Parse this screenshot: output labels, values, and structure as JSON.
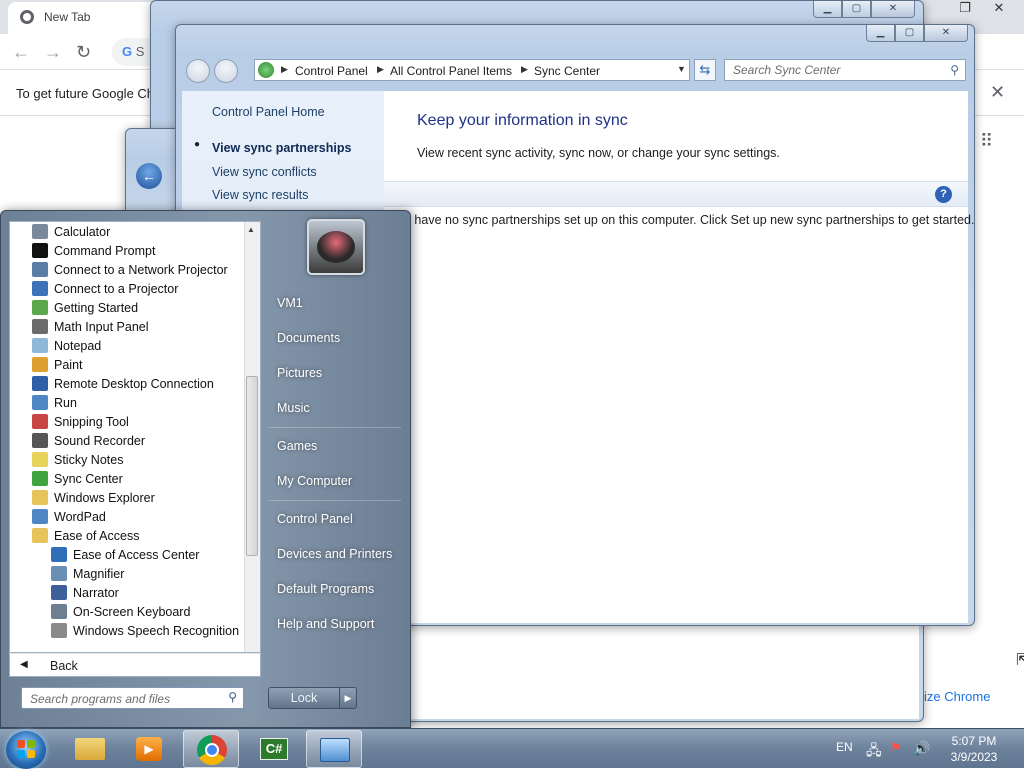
{
  "chrome": {
    "tab_title": "New Tab",
    "search_prefix": "S",
    "infobar_text": "To get future Google Ch",
    "customize_text": "ize Chrome",
    "apps_icon": "grid-icon"
  },
  "sync_window": {
    "breadcrumbs": [
      "Control Panel",
      "All Control Panel Items",
      "Sync Center"
    ],
    "search_placeholder": "Search Sync Center",
    "nav_links": {
      "home": "Control Panel Home",
      "partnerships": "View sync partnerships",
      "conflicts": "View sync conflicts",
      "results": "View sync results"
    },
    "heading": "Keep your information in sync",
    "subheading": "View recent sync activity, sync now, or change your sync settings.",
    "message": "u have no sync partnerships set up on this computer. Click Set up new sync partnerships to get started."
  },
  "start_menu": {
    "programs": [
      {
        "label": "Calculator",
        "color": "#7a8a9c"
      },
      {
        "label": "Command Prompt",
        "color": "#111111"
      },
      {
        "label": "Connect to a Network Projector",
        "color": "#5a7ea8"
      },
      {
        "label": "Connect to a Projector",
        "color": "#3d73b8"
      },
      {
        "label": "Getting Started",
        "color": "#5aa84a"
      },
      {
        "label": "Math Input Panel",
        "color": "#6b6b6b"
      },
      {
        "label": "Notepad",
        "color": "#8fb7d8"
      },
      {
        "label": "Paint",
        "color": "#e0a030"
      },
      {
        "label": "Remote Desktop Connection",
        "color": "#2f5fa8"
      },
      {
        "label": "Run",
        "color": "#4f86c6"
      },
      {
        "label": "Snipping Tool",
        "color": "#c74545"
      },
      {
        "label": "Sound Recorder",
        "color": "#555555"
      },
      {
        "label": "Sticky Notes",
        "color": "#e8d35a"
      },
      {
        "label": "Sync Center",
        "color": "#3fa43f"
      },
      {
        "label": "Windows Explorer",
        "color": "#e8c35a"
      },
      {
        "label": "WordPad",
        "color": "#4f86c6"
      },
      {
        "label": "Ease of Access",
        "color": "#e8c35a"
      }
    ],
    "subprograms": [
      {
        "label": "Ease of Access Center",
        "color": "#2f6fb8"
      },
      {
        "label": "Magnifier",
        "color": "#6a8fb5"
      },
      {
        "label": "Narrator",
        "color": "#3d5f9a"
      },
      {
        "label": "On-Screen Keyboard",
        "color": "#6f7f92"
      },
      {
        "label": "Windows Speech Recognition",
        "color": "#8a8a8a"
      }
    ],
    "back_label": "Back",
    "search_placeholder": "Search programs and files",
    "right_items": {
      "user": "VM1",
      "documents": "Documents",
      "pictures": "Pictures",
      "music": "Music",
      "games": "Games",
      "computer": "My Computer",
      "control_panel": "Control Panel",
      "devices": "Devices and Printers",
      "defaults": "Default Programs",
      "help": "Help and Support"
    },
    "lock_label": "Lock"
  },
  "taskbar": {
    "language": "EN",
    "time": "5:07 PM",
    "date": "3/9/2023"
  }
}
